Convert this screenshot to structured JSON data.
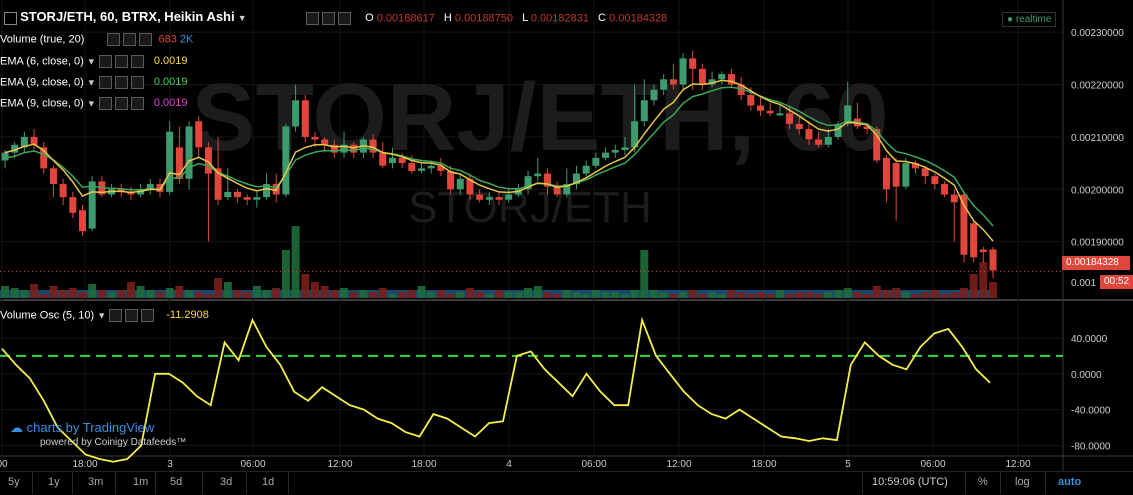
{
  "header": {
    "symbol": "STORJ/ETH, 60, BTRX, Heikin Ashi",
    "o_label": "O",
    "o_value": "0.00188617",
    "h_label": "H",
    "h_value": "0.00188750",
    "l_label": "L",
    "l_value": "0.00182831",
    "c_label": "C",
    "c_value": "0.00184328",
    "realtime": "realtime"
  },
  "indicators": [
    {
      "label": "Volume (true, 20)",
      "v1": "683",
      "v2": "2K",
      "color1": "#e0413b",
      "color2": "#3b8fe0"
    },
    {
      "label": "EMA (6, close, 0)",
      "v1": "0.0019",
      "color1": "#ffd84a"
    },
    {
      "label": "EMA (9, close, 0)",
      "v1": "0.0019",
      "color1": "#32d94a"
    },
    {
      "label": "EMA (9, close, 0)",
      "v1": "0.0019",
      "color1": "#e040e0"
    }
  ],
  "watermark": {
    "big": "STORJ/ETH, 60",
    "small": "STORJ/ETH"
  },
  "price_axis": {
    "ticks": [
      "0.00230000",
      "0.00220000",
      "0.00210000",
      "0.00200000",
      "0.00190000"
    ],
    "current": "0.00184328",
    "partial": "0.001",
    "countdown": "00:52"
  },
  "osc": {
    "label": "Volume Osc (5, 10)",
    "value": "-11.2908",
    "ticks": [
      "40.0000",
      "0.0000",
      "-40.0000",
      "-80.0000"
    ]
  },
  "time_axis": [
    "00",
    "18:00",
    "3",
    "06:00",
    "12:00",
    "18:00",
    "4",
    "06:00",
    "12:00",
    "18:00",
    "5",
    "06:00",
    "12:00"
  ],
  "branding": {
    "line1": "charts by TradingView",
    "line2": "powered by Coinigy Datafeeds™"
  },
  "toolbar": {
    "ranges": [
      "5y",
      "1y",
      "3m",
      "1m",
      "5d",
      "3d",
      "1d"
    ],
    "clock": "10:59:06 (UTC)",
    "pct": "%",
    "log": "log",
    "auto": "auto"
  },
  "colors": {
    "up": "#3e9b6e",
    "down": "#e0463c",
    "ema6": "#e6c64a",
    "ema9": "#3aa85a",
    "osc": "#f5ef4a",
    "zero_dash": "#3cd44a"
  },
  "chart_data": {
    "type": "candlestick",
    "series": "Heikin Ashi",
    "candles": [
      [
        0.002055,
        0.00207,
        0.00204,
        0.002075
      ],
      [
        0.00207,
        0.002085,
        0.00206,
        0.00209
      ],
      [
        0.00208,
        0.0021,
        0.00207,
        0.00211
      ],
      [
        0.0021,
        0.002085,
        0.002075,
        0.002115
      ],
      [
        0.00208,
        0.00204,
        0.00203,
        0.00209
      ],
      [
        0.00204,
        0.00201,
        0.001985,
        0.002045
      ],
      [
        0.00201,
        0.001985,
        0.00197,
        0.00202
      ],
      [
        0.001985,
        0.001955,
        0.001945,
        0.001995
      ],
      [
        0.00196,
        0.00192,
        0.00191,
        0.00197
      ],
      [
        0.001925,
        0.002015,
        0.00192,
        0.002025
      ],
      [
        0.002015,
        0.00199,
        0.001985,
        0.002025
      ],
      [
        0.00199,
        0.002,
        0.001985,
        0.00201
      ],
      [
        0.002,
        0.001995,
        0.001985,
        0.00201
      ],
      [
        0.001995,
        0.00199,
        0.00198,
        0.002005
      ],
      [
        0.00199,
        0.002,
        0.001985,
        0.00201
      ],
      [
        0.002,
        0.00201,
        0.00199,
        0.00202
      ],
      [
        0.00201,
        0.001995,
        0.001985,
        0.00202
      ],
      [
        0.001995,
        0.00211,
        0.00199,
        0.00213
      ],
      [
        0.00208,
        0.00202,
        0.00201,
        0.00212
      ],
      [
        0.00202,
        0.00212,
        0.002,
        0.00213
      ],
      [
        0.00213,
        0.00208,
        0.00206,
        0.00214
      ],
      [
        0.00208,
        0.00203,
        0.0019,
        0.00209
      ],
      [
        0.00204,
        0.00198,
        0.00197,
        0.0021
      ],
      [
        0.001985,
        0.001995,
        0.00198,
        0.00204
      ],
      [
        0.001995,
        0.001985,
        0.001975,
        0.002
      ],
      [
        0.001985,
        0.00198,
        0.00197,
        0.00199
      ],
      [
        0.00198,
        0.001985,
        0.001965,
        0.001995
      ],
      [
        0.001985,
        0.00201,
        0.00198,
        0.00203
      ],
      [
        0.00201,
        0.00199,
        0.001975,
        0.00203
      ],
      [
        0.00199,
        0.00212,
        0.001985,
        0.002125
      ],
      [
        0.00212,
        0.00217,
        0.00211,
        0.0022
      ],
      [
        0.00217,
        0.0021,
        0.00209,
        0.00218
      ],
      [
        0.0021,
        0.002095,
        0.00208,
        0.00211
      ],
      [
        0.002095,
        0.002085,
        0.00207,
        0.0021
      ],
      [
        0.002085,
        0.00207,
        0.00206,
        0.002095
      ],
      [
        0.00207,
        0.002085,
        0.00206,
        0.00211
      ],
      [
        0.002085,
        0.00207,
        0.00206,
        0.00209
      ],
      [
        0.00207,
        0.002095,
        0.00206,
        0.0021
      ],
      [
        0.002095,
        0.00207,
        0.00206,
        0.002105
      ],
      [
        0.00207,
        0.002045,
        0.00204,
        0.00209
      ],
      [
        0.00205,
        0.00206,
        0.00204,
        0.00208
      ],
      [
        0.00206,
        0.00205,
        0.00204,
        0.00207
      ],
      [
        0.00205,
        0.002035,
        0.00203,
        0.002065
      ],
      [
        0.002035,
        0.00204,
        0.00203,
        0.00205
      ],
      [
        0.00204,
        0.002045,
        0.00203,
        0.002055
      ],
      [
        0.002045,
        0.002035,
        0.002025,
        0.00206
      ],
      [
        0.002035,
        0.002,
        0.00199,
        0.002045
      ],
      [
        0.002,
        0.00202,
        0.00199,
        0.00203
      ],
      [
        0.00202,
        0.00199,
        0.00198,
        0.00203
      ],
      [
        0.00199,
        0.00198,
        0.001975,
        0.002
      ],
      [
        0.00198,
        0.001985,
        0.00197,
        0.001995
      ],
      [
        0.001985,
        0.00198,
        0.00197,
        0.001995
      ],
      [
        0.00198,
        0.00199,
        0.001975,
        0.002
      ],
      [
        0.00199,
        0.002,
        0.001985,
        0.00201
      ],
      [
        0.002,
        0.002025,
        0.00199,
        0.002035
      ],
      [
        0.002025,
        0.00203,
        0.002015,
        0.00206
      ],
      [
        0.00203,
        0.002005,
        0.00199,
        0.00204
      ],
      [
        0.002005,
        0.00199,
        0.001985,
        0.002015
      ],
      [
        0.00199,
        0.00201,
        0.001985,
        0.00204
      ],
      [
        0.00201,
        0.00203,
        0.002,
        0.002045
      ],
      [
        0.00203,
        0.002045,
        0.002025,
        0.002055
      ],
      [
        0.002045,
        0.00206,
        0.00204,
        0.00207
      ],
      [
        0.00206,
        0.00207,
        0.002055,
        0.00208
      ],
      [
        0.00207,
        0.002075,
        0.00206,
        0.002085
      ],
      [
        0.002075,
        0.00208,
        0.002065,
        0.0021
      ],
      [
        0.00208,
        0.00213,
        0.00207,
        0.0022
      ],
      [
        0.00213,
        0.00217,
        0.00212,
        0.00221
      ],
      [
        0.00217,
        0.00219,
        0.00216,
        0.0022
      ],
      [
        0.00219,
        0.00221,
        0.00218,
        0.00222
      ],
      [
        0.00221,
        0.0022,
        0.00219,
        0.00224
      ],
      [
        0.0022,
        0.00225,
        0.00219,
        0.00226
      ],
      [
        0.00225,
        0.00223,
        0.00219,
        0.002265
      ],
      [
        0.00223,
        0.0022,
        0.00219,
        0.00224
      ],
      [
        0.0022,
        0.00221,
        0.002195,
        0.002225
      ],
      [
        0.00221,
        0.00222,
        0.0022,
        0.002225
      ],
      [
        0.00222,
        0.0022,
        0.002195,
        0.00223
      ],
      [
        0.0022,
        0.00218,
        0.00217,
        0.002215
      ],
      [
        0.00218,
        0.00216,
        0.00215,
        0.002195
      ],
      [
        0.00216,
        0.00215,
        0.00214,
        0.002175
      ],
      [
        0.00215,
        0.002145,
        0.00214,
        0.002165
      ],
      [
        0.002145,
        0.002145,
        0.00214,
        0.00216
      ],
      [
        0.002145,
        0.002125,
        0.002115,
        0.00216
      ],
      [
        0.002125,
        0.002115,
        0.002105,
        0.00214
      ],
      [
        0.002115,
        0.002095,
        0.002085,
        0.00213
      ],
      [
        0.002095,
        0.002085,
        0.00208,
        0.00211
      ],
      [
        0.002085,
        0.0021,
        0.00208,
        0.002115
      ],
      [
        0.0021,
        0.002125,
        0.002095,
        0.00213
      ],
      [
        0.002125,
        0.00216,
        0.00212,
        0.002205
      ],
      [
        0.002135,
        0.00212,
        0.002115,
        0.002165
      ],
      [
        0.00212,
        0.002115,
        0.002105,
        0.002125
      ],
      [
        0.002115,
        0.002055,
        0.00205,
        0.00212
      ],
      [
        0.00206,
        0.002,
        0.001975,
        0.002065
      ],
      [
        0.00205,
        0.002005,
        0.00194,
        0.00206
      ],
      [
        0.002005,
        0.00205,
        0.002,
        0.00206
      ],
      [
        0.00205,
        0.00204,
        0.00203,
        0.002055
      ],
      [
        0.00204,
        0.002025,
        0.00201,
        0.002045
      ],
      [
        0.002025,
        0.00201,
        0.002,
        0.00203
      ],
      [
        0.00201,
        0.00199,
        0.001985,
        0.002015
      ],
      [
        0.00199,
        0.001975,
        0.0019,
        0.002
      ],
      [
        0.00199,
        0.001875,
        0.00186,
        0.001995
      ],
      [
        0.001935,
        0.00187,
        0.00186,
        0.00194
      ],
      [
        0.001885,
        0.00188,
        0.00186,
        0.00189
      ],
      [
        0.001885,
        0.001845,
        0.00183,
        0.00189
      ]
    ],
    "ema6": [
      0.00207,
      0.002075,
      0.002082,
      0.002086,
      0.002074,
      0.002055,
      0.002037,
      0.002014,
      0.001987,
      0.001995,
      0.001994,
      0.001996,
      0.001996,
      0.001994,
      0.001996,
      0.002,
      0.001999,
      0.002031,
      0.002028,
      0.002054,
      0.002061,
      0.002052,
      0.002031,
      0.002021,
      0.002011,
      0.002002,
      0.001997,
      0.002001,
      0.001998,
      0.002032,
      0.002071,
      0.00208,
      0.002085,
      0.002085,
      0.002081,
      0.002082,
      0.002079,
      0.002083,
      0.00208,
      0.00207,
      0.002067,
      0.002062,
      0.002055,
      0.002051,
      0.00205,
      0.002046,
      0.002033,
      0.002029,
      0.002018,
      0.002008,
      0.002001,
      0.001995,
      0.001994,
      0.001996,
      0.002004,
      0.002012,
      0.00201,
      0.002004,
      0.002006,
      0.002013,
      0.002022,
      0.002033,
      0.002044,
      0.002053,
      0.002061,
      0.00208,
      0.002106,
      0.00213,
      0.002153,
      0.002166,
      0.00219,
      0.002201,
      0.0022,
      0.002203,
      0.002208,
      0.002206,
      0.002199,
      0.002188,
      0.002177,
      0.002168,
      0.002162,
      0.002151,
      0.00214,
      0.002127,
      0.002115,
      0.002111,
      0.002115,
      0.002128,
      0.002126,
      0.002123,
      0.002103,
      0.002074,
      0.002054,
      0.002053,
      0.002049,
      0.002042,
      0.002033,
      0.002021,
      0.002008,
      0.00197,
      0.00194,
      0.001923,
      0.001901
    ],
    "ema9": [
      0.00206,
      0.002063,
      0.00207,
      0.002073,
      0.002067,
      0.002056,
      0.002042,
      0.002025,
      0.002004,
      0.002006,
      0.002003,
      0.002002,
      0.002001,
      0.001999,
      0.001999,
      0.002001,
      0.002,
      0.002022,
      0.002021,
      0.002041,
      0.002049,
      0.002045,
      0.002032,
      0.002025,
      0.002017,
      0.00201,
      0.002005,
      0.002006,
      0.002003,
      0.002027,
      0.002056,
      0.002065,
      0.002071,
      0.002074,
      0.002073,
      0.002075,
      0.002074,
      0.002078,
      0.002077,
      0.00207,
      0.002068,
      0.002064,
      0.002058,
      0.002055,
      0.002053,
      0.00205,
      0.00204,
      0.002036,
      0.002027,
      0.002017,
      0.002011,
      0.002004,
      0.002001,
      0.002001,
      0.002006,
      0.002011,
      0.00201,
      0.002006,
      0.002007,
      0.002012,
      0.002018,
      0.002027,
      0.002035,
      0.002043,
      0.00205,
      0.002066,
      0.002087,
      0.002107,
      0.002128,
      0.002142,
      0.002164,
      0.002177,
      0.002182,
      0.002188,
      0.002194,
      0.002195,
      0.002192,
      0.002185,
      0.002178,
      0.002171,
      0.002166,
      0.002158,
      0.002149,
      0.002138,
      0.002128,
      0.002122,
      0.002123,
      0.00213,
      0.002128,
      0.002125,
      0.002111,
      0.002089,
      0.002072,
      0.002068,
      0.002062,
      0.002055,
      0.002046,
      0.002035,
      0.002023,
      0.001994,
      0.001969,
      0.001951,
      0.00193
    ],
    "volume": [
      30,
      25,
      20,
      35,
      10,
      30,
      20,
      25,
      15,
      35,
      20,
      15,
      20,
      40,
      30,
      20,
      15,
      25,
      30,
      20,
      15,
      10,
      50,
      40,
      20,
      15,
      30,
      20,
      25,
      120,
      180,
      60,
      40,
      30,
      20,
      25,
      15,
      20,
      15,
      25,
      10,
      15,
      20,
      30,
      15,
      20,
      10,
      15,
      25,
      15,
      10,
      20,
      15,
      15,
      25,
      30,
      15,
      10,
      20,
      15,
      10,
      20,
      15,
      15,
      10,
      20,
      120,
      20,
      15,
      10,
      15,
      20,
      10,
      15,
      10,
      20,
      15,
      10,
      15,
      10,
      20,
      10,
      15,
      15,
      10,
      15,
      20,
      25,
      15,
      10,
      30,
      20,
      25,
      15,
      10,
      15,
      20,
      10,
      15,
      25,
      60,
      90,
      40
    ],
    "osc": [
      28,
      10,
      -5,
      -30,
      -60,
      -75,
      -90,
      -95,
      -98,
      -95,
      -80,
      0,
      0,
      -10,
      -25,
      -35,
      35,
      15,
      60,
      30,
      10,
      -20,
      -30,
      -15,
      -25,
      -35,
      -40,
      -50,
      -55,
      -65,
      -70,
      -45,
      -50,
      -60,
      -70,
      -55,
      -53,
      20,
      25,
      5,
      -10,
      -25,
      0,
      -20,
      -35,
      -35,
      60,
      20,
      0,
      -20,
      -35,
      -45,
      -50,
      -40,
      -50,
      -60,
      -70,
      -72,
      -75,
      -72,
      -74,
      10,
      35,
      20,
      10,
      5,
      30,
      45,
      50,
      30,
      5,
      -10
    ],
    "axis": {
      "price_range": [
        0.0018,
        0.00235
      ],
      "osc_range": [
        -85,
        70
      ]
    }
  }
}
